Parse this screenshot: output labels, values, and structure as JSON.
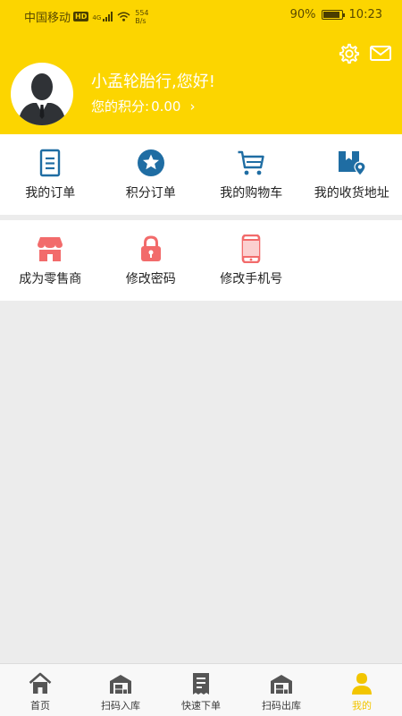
{
  "status_bar": {
    "carrier": "中国移动",
    "hd": "HD",
    "network": "4G",
    "speed_value": "554",
    "speed_unit": "B/s",
    "battery": "90%",
    "battery_level": 0.9,
    "time": "10:23"
  },
  "profile": {
    "greeting": "小孟轮胎行,您好!",
    "points_label": "您的积分:",
    "points_value": "0.00",
    "icons": [
      "settings-icon",
      "message-icon",
      "avatar-silhouette"
    ]
  },
  "menu_primary": [
    {
      "label": "我的订单",
      "icon": "order-list-icon"
    },
    {
      "label": "积分订单",
      "icon": "star-circle-icon"
    },
    {
      "label": "我的购物车",
      "icon": "cart-icon"
    },
    {
      "label": "我的收货地址",
      "icon": "address-box-icon"
    }
  ],
  "menu_secondary": [
    {
      "label": "成为零售商",
      "icon": "store-icon"
    },
    {
      "label": "修改密码",
      "icon": "lock-icon"
    },
    {
      "label": "修改手机号",
      "icon": "phone-icon"
    }
  ],
  "tabbar": [
    {
      "label": "首页",
      "icon": "home-icon",
      "active": false
    },
    {
      "label": "扫码入库",
      "icon": "warehouse-in-icon",
      "active": false
    },
    {
      "label": "快速下单",
      "icon": "receipt-icon",
      "active": false
    },
    {
      "label": "扫码出库",
      "icon": "warehouse-out-icon",
      "active": false
    },
    {
      "label": "我的",
      "icon": "user-icon",
      "active": true
    }
  ],
  "colors": {
    "brand_yellow": "#fcd500",
    "icon_blue": "#1f6da3",
    "icon_red": "#f26b6b",
    "tab_active": "#f2c500",
    "page_bg": "#ececec"
  }
}
